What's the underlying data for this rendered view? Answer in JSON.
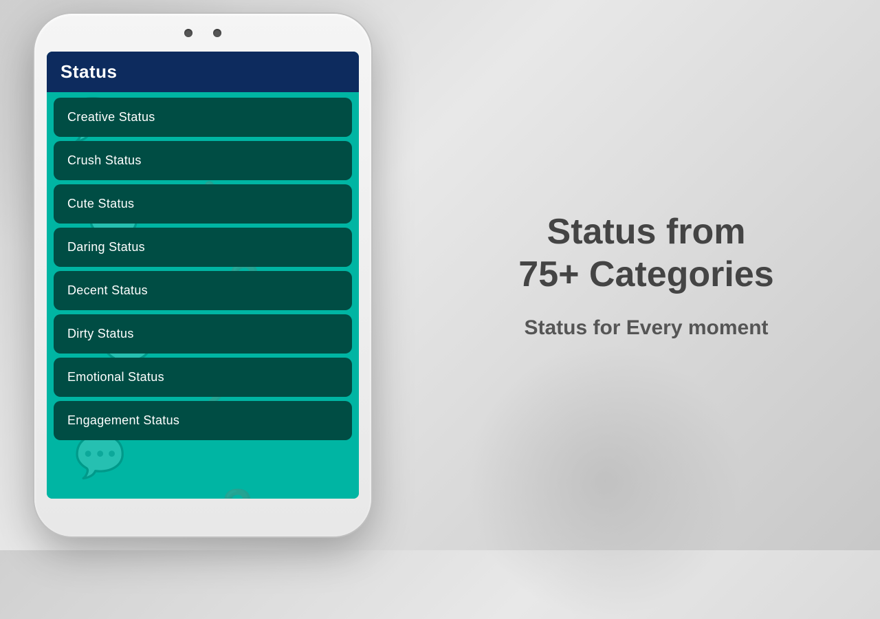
{
  "background": {
    "color": "#d8d8d8"
  },
  "phone": {
    "header": {
      "title": "Status",
      "background_color": "#0d2b5e"
    },
    "screen_background": "#00b5a3",
    "menu_items": [
      {
        "id": "creative-status",
        "label": "Creative Status"
      },
      {
        "id": "crush-status",
        "label": "Crush Status"
      },
      {
        "id": "cute-status",
        "label": "Cute Status"
      },
      {
        "id": "daring-status",
        "label": "Daring Status"
      },
      {
        "id": "decent-status",
        "label": "Decent Status"
      },
      {
        "id": "dirty-status",
        "label": "Dirty Status"
      },
      {
        "id": "emotional-status",
        "label": "Emotional Status"
      },
      {
        "id": "engagement-status",
        "label": "Engagement Status"
      }
    ]
  },
  "right_panel": {
    "tagline_main": "Status from\n75+ Categories",
    "tagline_sub": "Status for Every moment"
  }
}
